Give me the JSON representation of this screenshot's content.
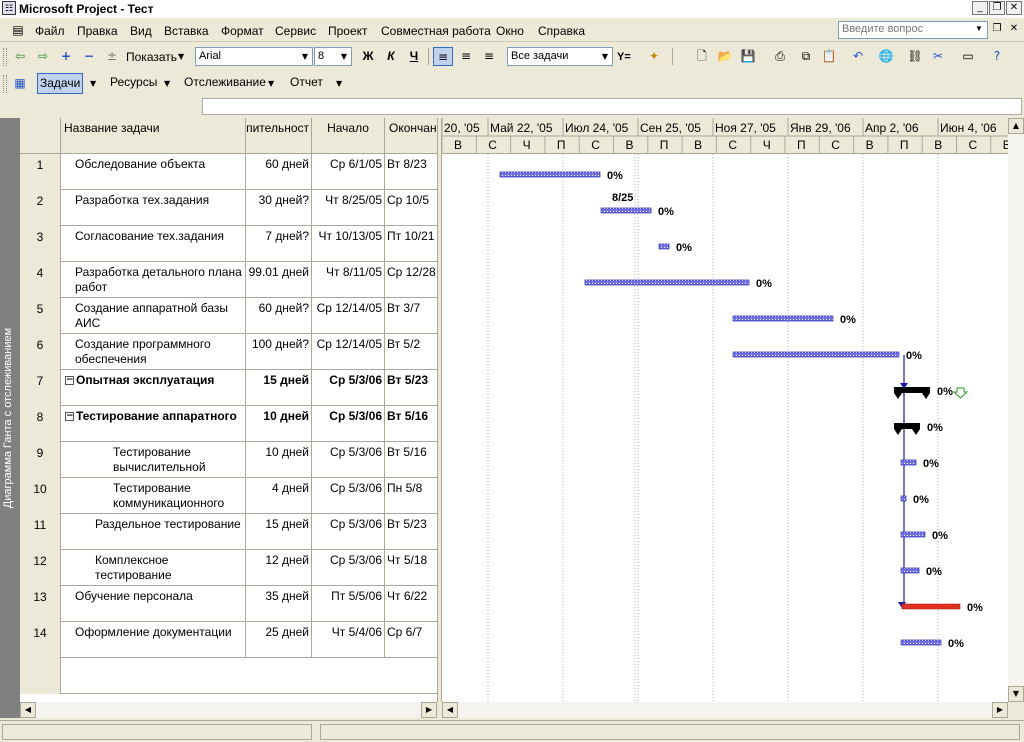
{
  "window": {
    "title": "Microsoft Project - Тест",
    "controls": [
      "_",
      "❐",
      "✕"
    ],
    "doc_controls": [
      "_",
      "❐",
      "✕"
    ]
  },
  "menu": {
    "items": [
      "Файл",
      "Правка",
      "Вид",
      "Вставка",
      "Формат",
      "Сервис",
      "Проект",
      "Совместная работа",
      "Окно",
      "Справка"
    ],
    "ask_placeholder": "Введите вопрос"
  },
  "toolbar": {
    "show_label": "Показать",
    "font": "Arial",
    "font_size": "8",
    "bold": "Ж",
    "italic": "К",
    "underline": "Ч",
    "filter": "Все задачи",
    "filter_icon": "Y="
  },
  "toolbar2": {
    "tasks": "Задачи",
    "resources": "Ресурсы",
    "tracking": "Отслеживание",
    "report": "Отчет"
  },
  "view_bar": {
    "label": "Диаграмма Ганта с отслеживанием"
  },
  "table": {
    "headers": {
      "name": "Название задачи",
      "duration": "пительност",
      "start": "Начало",
      "finish": "Окончан"
    },
    "rows": [
      {
        "id": "1",
        "name": "Обследование объекта",
        "duration": "60 дней",
        "start": "Ср 6/1/05",
        "finish": "Вт 8/23",
        "indent": 1,
        "bold": false,
        "summary": false
      },
      {
        "id": "2",
        "name": "Разработка тех.задания",
        "duration": "30 дней?",
        "start": "Чт 8/25/05",
        "finish": "Ср 10/5",
        "indent": 1,
        "bold": false,
        "summary": false
      },
      {
        "id": "3",
        "name": "Согласование тех.задания",
        "duration": "7 дней?",
        "start": "Чт 10/13/05",
        "finish": "Пт 10/21",
        "indent": 1,
        "bold": false,
        "summary": false
      },
      {
        "id": "4",
        "name": "Разработка детального плана работ",
        "duration": "99.01 дней",
        "start": "Чт 8/11/05",
        "finish": "Ср 12/28",
        "indent": 1,
        "bold": false,
        "summary": false
      },
      {
        "id": "5",
        "name": "Создание аппаратной базы АИС",
        "duration": "60 дней?",
        "start": "Ср 12/14/05",
        "finish": "Вт 3/7",
        "indent": 1,
        "bold": false,
        "summary": false
      },
      {
        "id": "6",
        "name": "Создание программного обеспечения",
        "duration": "100 дней?",
        "start": "Ср 12/14/05",
        "finish": "Вт 5/2",
        "indent": 1,
        "bold": false,
        "summary": false
      },
      {
        "id": "7",
        "name": "Опытная эксплуатация",
        "duration": "15 дней",
        "start": "Ср 5/3/06",
        "finish": "Вт 5/23",
        "indent": 0,
        "bold": true,
        "summary": true
      },
      {
        "id": "8",
        "name": "Тестирование аппаратного",
        "duration": "10 дней",
        "start": "Ср 5/3/06",
        "finish": "Вт 5/16",
        "indent": 1,
        "bold": true,
        "summary": true
      },
      {
        "id": "9",
        "name": "Тестирование вычислительной",
        "duration": "10 дней",
        "start": "Ср 5/3/06",
        "finish": "Вт 5/16",
        "indent": 3,
        "bold": false,
        "summary": false
      },
      {
        "id": "10",
        "name": "Тестирование коммуникационного",
        "duration": "4 дней",
        "start": "Ср 5/3/06",
        "finish": "Пн 5/8",
        "indent": 3,
        "bold": false,
        "summary": false
      },
      {
        "id": "11",
        "name": "Раздельное тестирование",
        "duration": "15 дней",
        "start": "Ср 5/3/06",
        "finish": "Вт 5/23",
        "indent": 2,
        "bold": false,
        "summary": false
      },
      {
        "id": "12",
        "name": "Комплексное тестирование",
        "duration": "12 дней",
        "start": "Ср 5/3/06",
        "finish": "Чт 5/18",
        "indent": 2,
        "bold": false,
        "summary": false
      },
      {
        "id": "13",
        "name": "Обучение персонала",
        "duration": "35 дней",
        "start": "Пт 5/5/06",
        "finish": "Чт 6/22",
        "indent": 1,
        "bold": false,
        "summary": false
      },
      {
        "id": "14",
        "name": "Оформление документации",
        "duration": "25 дней",
        "start": "Чт 5/4/06",
        "finish": "Ср 6/7",
        "indent": 1,
        "bold": false,
        "summary": false
      }
    ]
  },
  "gantt": {
    "major_ticks": [
      "20, '05",
      "Май 22, '05",
      "Июл 24, '05",
      "Сен 25, '05",
      "Ноя 27, '05",
      "Янв 29, '06",
      "Апр 2, '06",
      "Июн 4, '06"
    ],
    "minor_ticks": [
      "В",
      "С",
      "Ч",
      "П",
      "С",
      "В",
      "П",
      "В",
      "С",
      "Ч",
      "П",
      "С",
      "В",
      "П",
      "В",
      "С",
      "В"
    ],
    "bars": [
      {
        "row": 1,
        "label": "0%",
        "color": "#4b4bd8",
        "kind": "task"
      },
      {
        "row": 2,
        "label": "0%",
        "color": "#4b4bd8",
        "kind": "task",
        "note": "8/25"
      },
      {
        "row": 3,
        "label": "0%",
        "color": "#4b4bd8",
        "kind": "task"
      },
      {
        "row": 4,
        "label": "0%",
        "color": "#4b4bd8",
        "kind": "task"
      },
      {
        "row": 5,
        "label": "0%",
        "color": "#4b4bd8",
        "kind": "task"
      },
      {
        "row": 6,
        "label": "0%",
        "color": "#4b4bd8",
        "kind": "task"
      },
      {
        "row": 7,
        "label": "0%",
        "color": "#000000",
        "kind": "summary"
      },
      {
        "row": 8,
        "label": "0%",
        "color": "#000000",
        "kind": "summary"
      },
      {
        "row": 9,
        "label": "0%",
        "color": "#4b4bd8",
        "kind": "task"
      },
      {
        "row": 10,
        "label": "0%",
        "color": "#4b4bd8",
        "kind": "task"
      },
      {
        "row": 11,
        "label": "0%",
        "color": "#4b4bd8",
        "kind": "task"
      },
      {
        "row": 12,
        "label": "0%",
        "color": "#4b4bd8",
        "kind": "task"
      },
      {
        "row": 13,
        "label": "0%",
        "color": "#e03020",
        "kind": "critical"
      },
      {
        "row": 14,
        "label": "0%",
        "color": "#4b4bd8",
        "kind": "task"
      }
    ]
  }
}
